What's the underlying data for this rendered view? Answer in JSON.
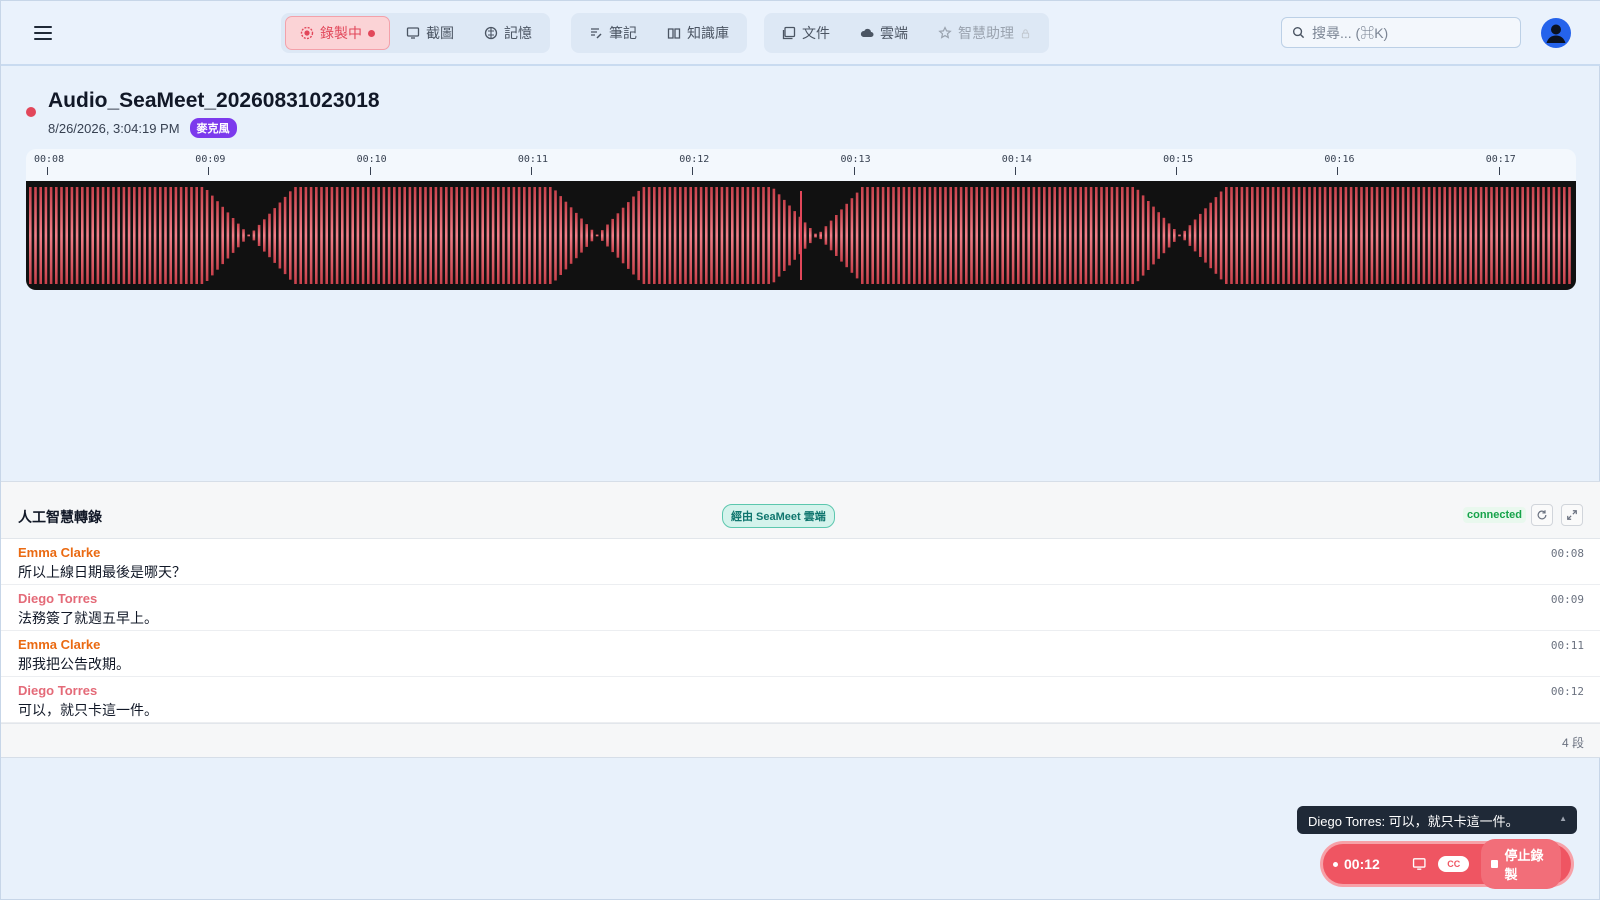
{
  "nav": {
    "group1": [
      {
        "label": "錄製中",
        "icon": "record-icon",
        "active": true
      },
      {
        "label": "截圖",
        "icon": "screenshot-icon"
      },
      {
        "label": "記憶",
        "icon": "brain-icon"
      }
    ],
    "group2": [
      {
        "label": "筆記",
        "icon": "notes-icon"
      },
      {
        "label": "知識庫",
        "icon": "book-icon"
      }
    ],
    "group3": [
      {
        "label": "文件",
        "icon": "documents-icon"
      },
      {
        "label": "雲端",
        "icon": "cloud-icon"
      },
      {
        "label": "智慧助理",
        "icon": "assistant-icon",
        "disabled": true
      }
    ]
  },
  "search": {
    "placeholder": "搜尋... (⌘K)"
  },
  "recording": {
    "title": "Audio_SeaMeet_20260831023018",
    "datetime": "8/26/2026, 3:04:19 PM",
    "source_badge": "麥克風"
  },
  "timeline": {
    "ticks": [
      "00:08",
      "00:09",
      "00:10",
      "00:11",
      "00:12",
      "00:13",
      "00:14",
      "00:15",
      "00:16",
      "00:17"
    ]
  },
  "transcript": {
    "title": "人工智慧轉錄",
    "source": "經由 SeaMeet 雲端",
    "status": "connected",
    "segments": [
      {
        "speaker": "Emma Clarke",
        "text": "所以上線日期最後是哪天？",
        "time": "00:08"
      },
      {
        "speaker": "Diego Torres",
        "text": "法務簽了就週五早上。",
        "time": "00:09"
      },
      {
        "speaker": "Emma Clarke",
        "text": "那我把公告改期。",
        "time": "00:11"
      },
      {
        "speaker": "Diego Torres",
        "text": "可以，就只卡這一件。",
        "time": "00:12"
      }
    ],
    "count_label": "4 段"
  },
  "caption": {
    "text": "Diego Torres: 可以，就只卡這一件。"
  },
  "recbar": {
    "time": "00:12",
    "cc": "CC",
    "stop": "停止錄製"
  },
  "colors": {
    "accent": "#e2475a",
    "speaker_a": "#ea6a12",
    "speaker_b": "#e46a78",
    "wave": "#e25560",
    "badge": "#7c3aed"
  }
}
